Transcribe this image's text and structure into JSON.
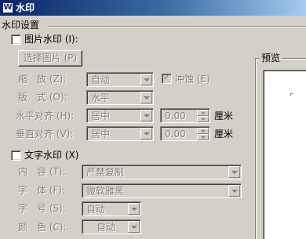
{
  "window": {
    "title": "水印",
    "icon": "app-w-icon"
  },
  "section": {
    "title": "水印设置"
  },
  "picture_watermark": {
    "checkbox_label": "图片水印 (I):",
    "checked": false,
    "select_picture_button": "选择图片 (P)",
    "scale_label": "缩　放 (Z):",
    "scale_value": "自动",
    "washout_label": "冲蚀 (E)",
    "washout_checked": true,
    "layout_label": "版　式 (O):",
    "layout_value": "水平",
    "h_align_label": "水平对齐 (H):",
    "h_align_value": "居中",
    "h_offset_value": "0.00",
    "h_unit": "厘米",
    "v_align_label": "垂直对齐 (V):",
    "v_align_value": "居中",
    "v_offset_value": "0.00",
    "v_unit": "厘米"
  },
  "text_watermark": {
    "checkbox_label": "文字水印 (X)",
    "checked": false,
    "content_label": "内　容 (T):",
    "content_value": "严禁复制",
    "font_label": "字　体 (F):",
    "font_value": "微软雅黑",
    "size_label": "字　号 (S):",
    "size_value": "自动",
    "color_label": "颜　色 (C):",
    "color_value": "自动"
  },
  "preview": {
    "title": "预览"
  },
  "colors": {
    "dialog_bg": "#d4d0c8",
    "titlebar_start": "#0a246a",
    "titlebar_end": "#a6caf0",
    "disabled_text": "#808080"
  }
}
